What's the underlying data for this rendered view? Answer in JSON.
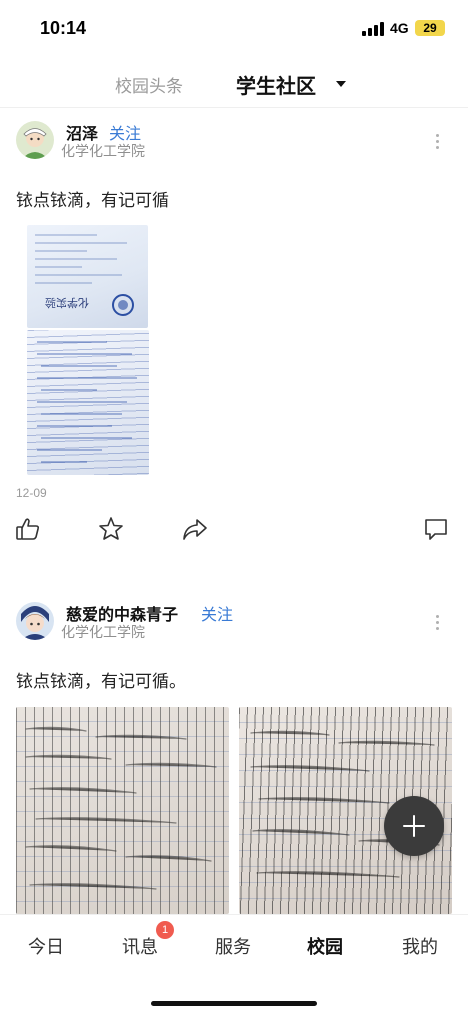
{
  "status_bar": {
    "time": "10:14",
    "network": "4G",
    "battery": "29",
    "battery_color": "#f2d64b"
  },
  "top_tabs": {
    "tabs": [
      {
        "label": "校园头条",
        "active": false
      },
      {
        "label": "学生社区",
        "active": true
      }
    ],
    "dropdown_icon": "caret-down-icon"
  },
  "posts": [
    {
      "author": "沼泽",
      "follow_label": "关注",
      "college": "化学化工学院",
      "text": "铱点铱滴，有记可循",
      "images": [
        {
          "icon": "chemistry-notes-photo"
        },
        {
          "icon": "chemistry-notes-photo"
        }
      ],
      "date": "12-09",
      "actions": [
        "thumbs-up-icon",
        "star-icon",
        "share-icon",
        "comment-icon"
      ]
    },
    {
      "author": "慈爱的中森青子",
      "follow_label": "关注",
      "college": "化学化工学院",
      "text": "铱点铱滴，有记可循。",
      "images": [
        {
          "icon": "notebook-photo"
        },
        {
          "icon": "notebook-photo"
        }
      ]
    }
  ],
  "fab": {
    "icon": "plus-icon"
  },
  "bottom_nav": {
    "items": [
      {
        "label": "今日",
        "active": false
      },
      {
        "label": "讯息",
        "active": false,
        "badge": "1"
      },
      {
        "label": "服务",
        "active": false
      },
      {
        "label": "校园",
        "active": true
      },
      {
        "label": "我的",
        "active": false
      }
    ],
    "accent": "#3a7bd5",
    "badge_color": "#f05b4f"
  }
}
